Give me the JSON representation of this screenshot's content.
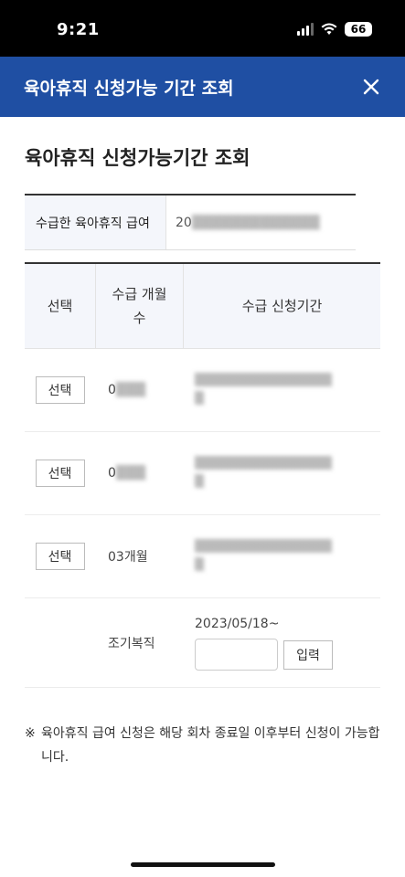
{
  "status_bar": {
    "time": "9:21",
    "battery": "66"
  },
  "header": {
    "title": "육아휴직 신청가능 기간 조회",
    "close_icon": "close-icon"
  },
  "page": {
    "title": "육아휴직 신청가능기간 조회"
  },
  "amount": {
    "label": "수급한 육아휴직 급여",
    "value": "20"
  },
  "table": {
    "headers": {
      "select": "선택",
      "months": "수급 개월 수",
      "period": "수급 신청기간"
    },
    "rows": [
      {
        "button": "선택",
        "months": "0",
        "period": ""
      },
      {
        "button": "선택",
        "months": "0",
        "period": ""
      },
      {
        "button": "선택",
        "months": "03개월",
        "period": ""
      }
    ],
    "early_return": {
      "label": "조기복직",
      "start": "2023/05/18~",
      "input_value": "",
      "button": "입력"
    }
  },
  "notice": {
    "mark": "※",
    "text": "육아휴직 급여 신청은 해당 회차 종료일 이후부터 신청이 가능합니다."
  },
  "colors": {
    "header_bg": "#1f4fa3",
    "table_header_bg": "#f4f6fb"
  }
}
